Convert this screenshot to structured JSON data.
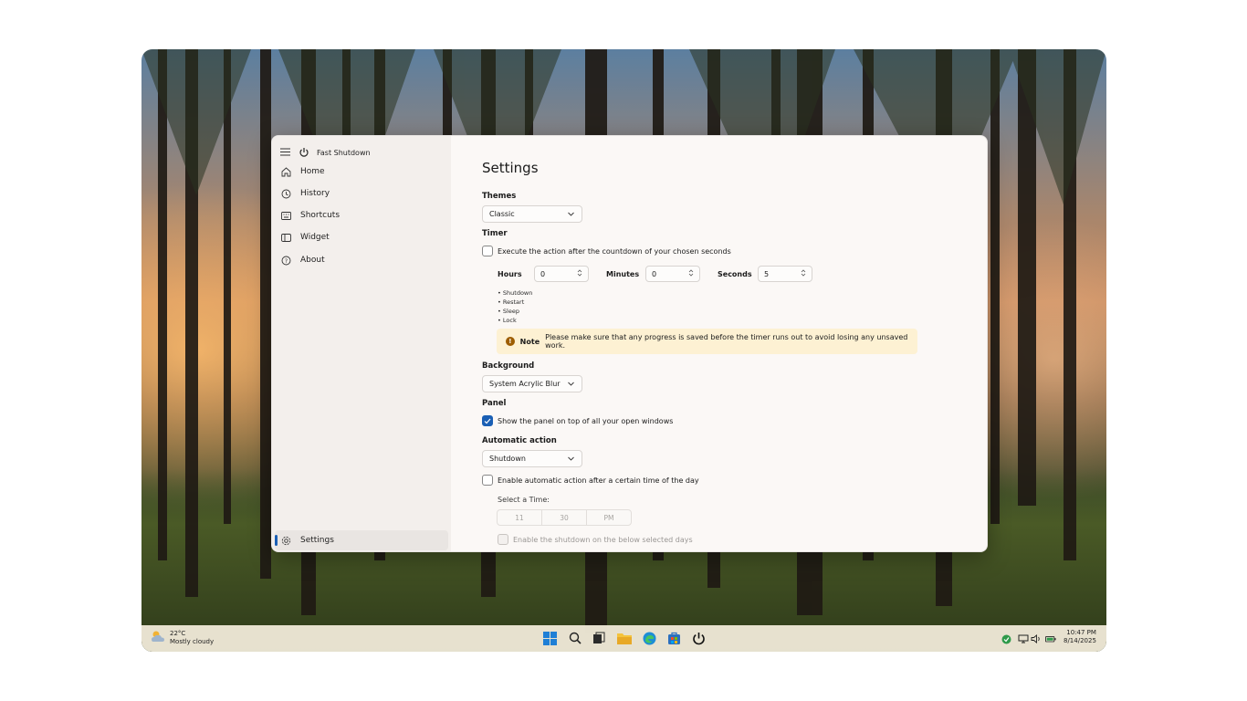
{
  "app": {
    "title": "Fast Shutdown"
  },
  "nav": {
    "items": [
      {
        "label": "Home",
        "icon": "home-icon"
      },
      {
        "label": "History",
        "icon": "history-icon"
      },
      {
        "label": "Shortcuts",
        "icon": "shortcuts-icon"
      },
      {
        "label": "Widget",
        "icon": "widget-icon"
      },
      {
        "label": "About",
        "icon": "about-icon"
      }
    ],
    "settings_label": "Settings"
  },
  "settings": {
    "title": "Settings",
    "themes": {
      "label": "Themes",
      "value": "Classic"
    },
    "timer": {
      "label": "Timer",
      "checkbox_label": "Execute the action after the countdown of your chosen seconds",
      "checked": false,
      "hours_label": "Hours",
      "hours_value": "0",
      "minutes_label": "Minutes",
      "minutes_value": "0",
      "seconds_label": "Seconds",
      "seconds_value": "5",
      "actions": [
        "• Shutdown",
        "• Restart",
        "• Sleep",
        "• Lock"
      ]
    },
    "note": {
      "title": "Note",
      "text": "Please make sure that any progress is saved before the timer runs out to avoid losing any unsaved work."
    },
    "background": {
      "label": "Background",
      "value": "System Acrylic Blur"
    },
    "panel": {
      "label": "Panel",
      "checkbox_label": "Show the panel on top of all your open windows",
      "checked": true
    },
    "automatic_action": {
      "label": "Automatic action",
      "value": "Shutdown",
      "checkbox_label": "Enable automatic action after a certain time of the day",
      "checked": false,
      "select_time_label": "Select a Time:",
      "time": {
        "hour": "11",
        "minute": "30",
        "period": "PM"
      },
      "days_checkbox_label": "Enable the shutdown on the below selected days"
    }
  },
  "taskbar": {
    "weather": {
      "temp": "22°C",
      "condition": "Mostly cloudy"
    },
    "apps": [
      "start-icon",
      "search-icon",
      "task-view-icon",
      "file-explorer-icon",
      "edge-icon",
      "store-icon",
      "fast-shutdown-icon"
    ],
    "clock": {
      "time": "10:47 PM",
      "date": "8/14/2025"
    }
  },
  "colors": {
    "accent": "#1a5fb4",
    "note_bg": "#fdf1d3",
    "note_icon": "#9d5d00"
  }
}
